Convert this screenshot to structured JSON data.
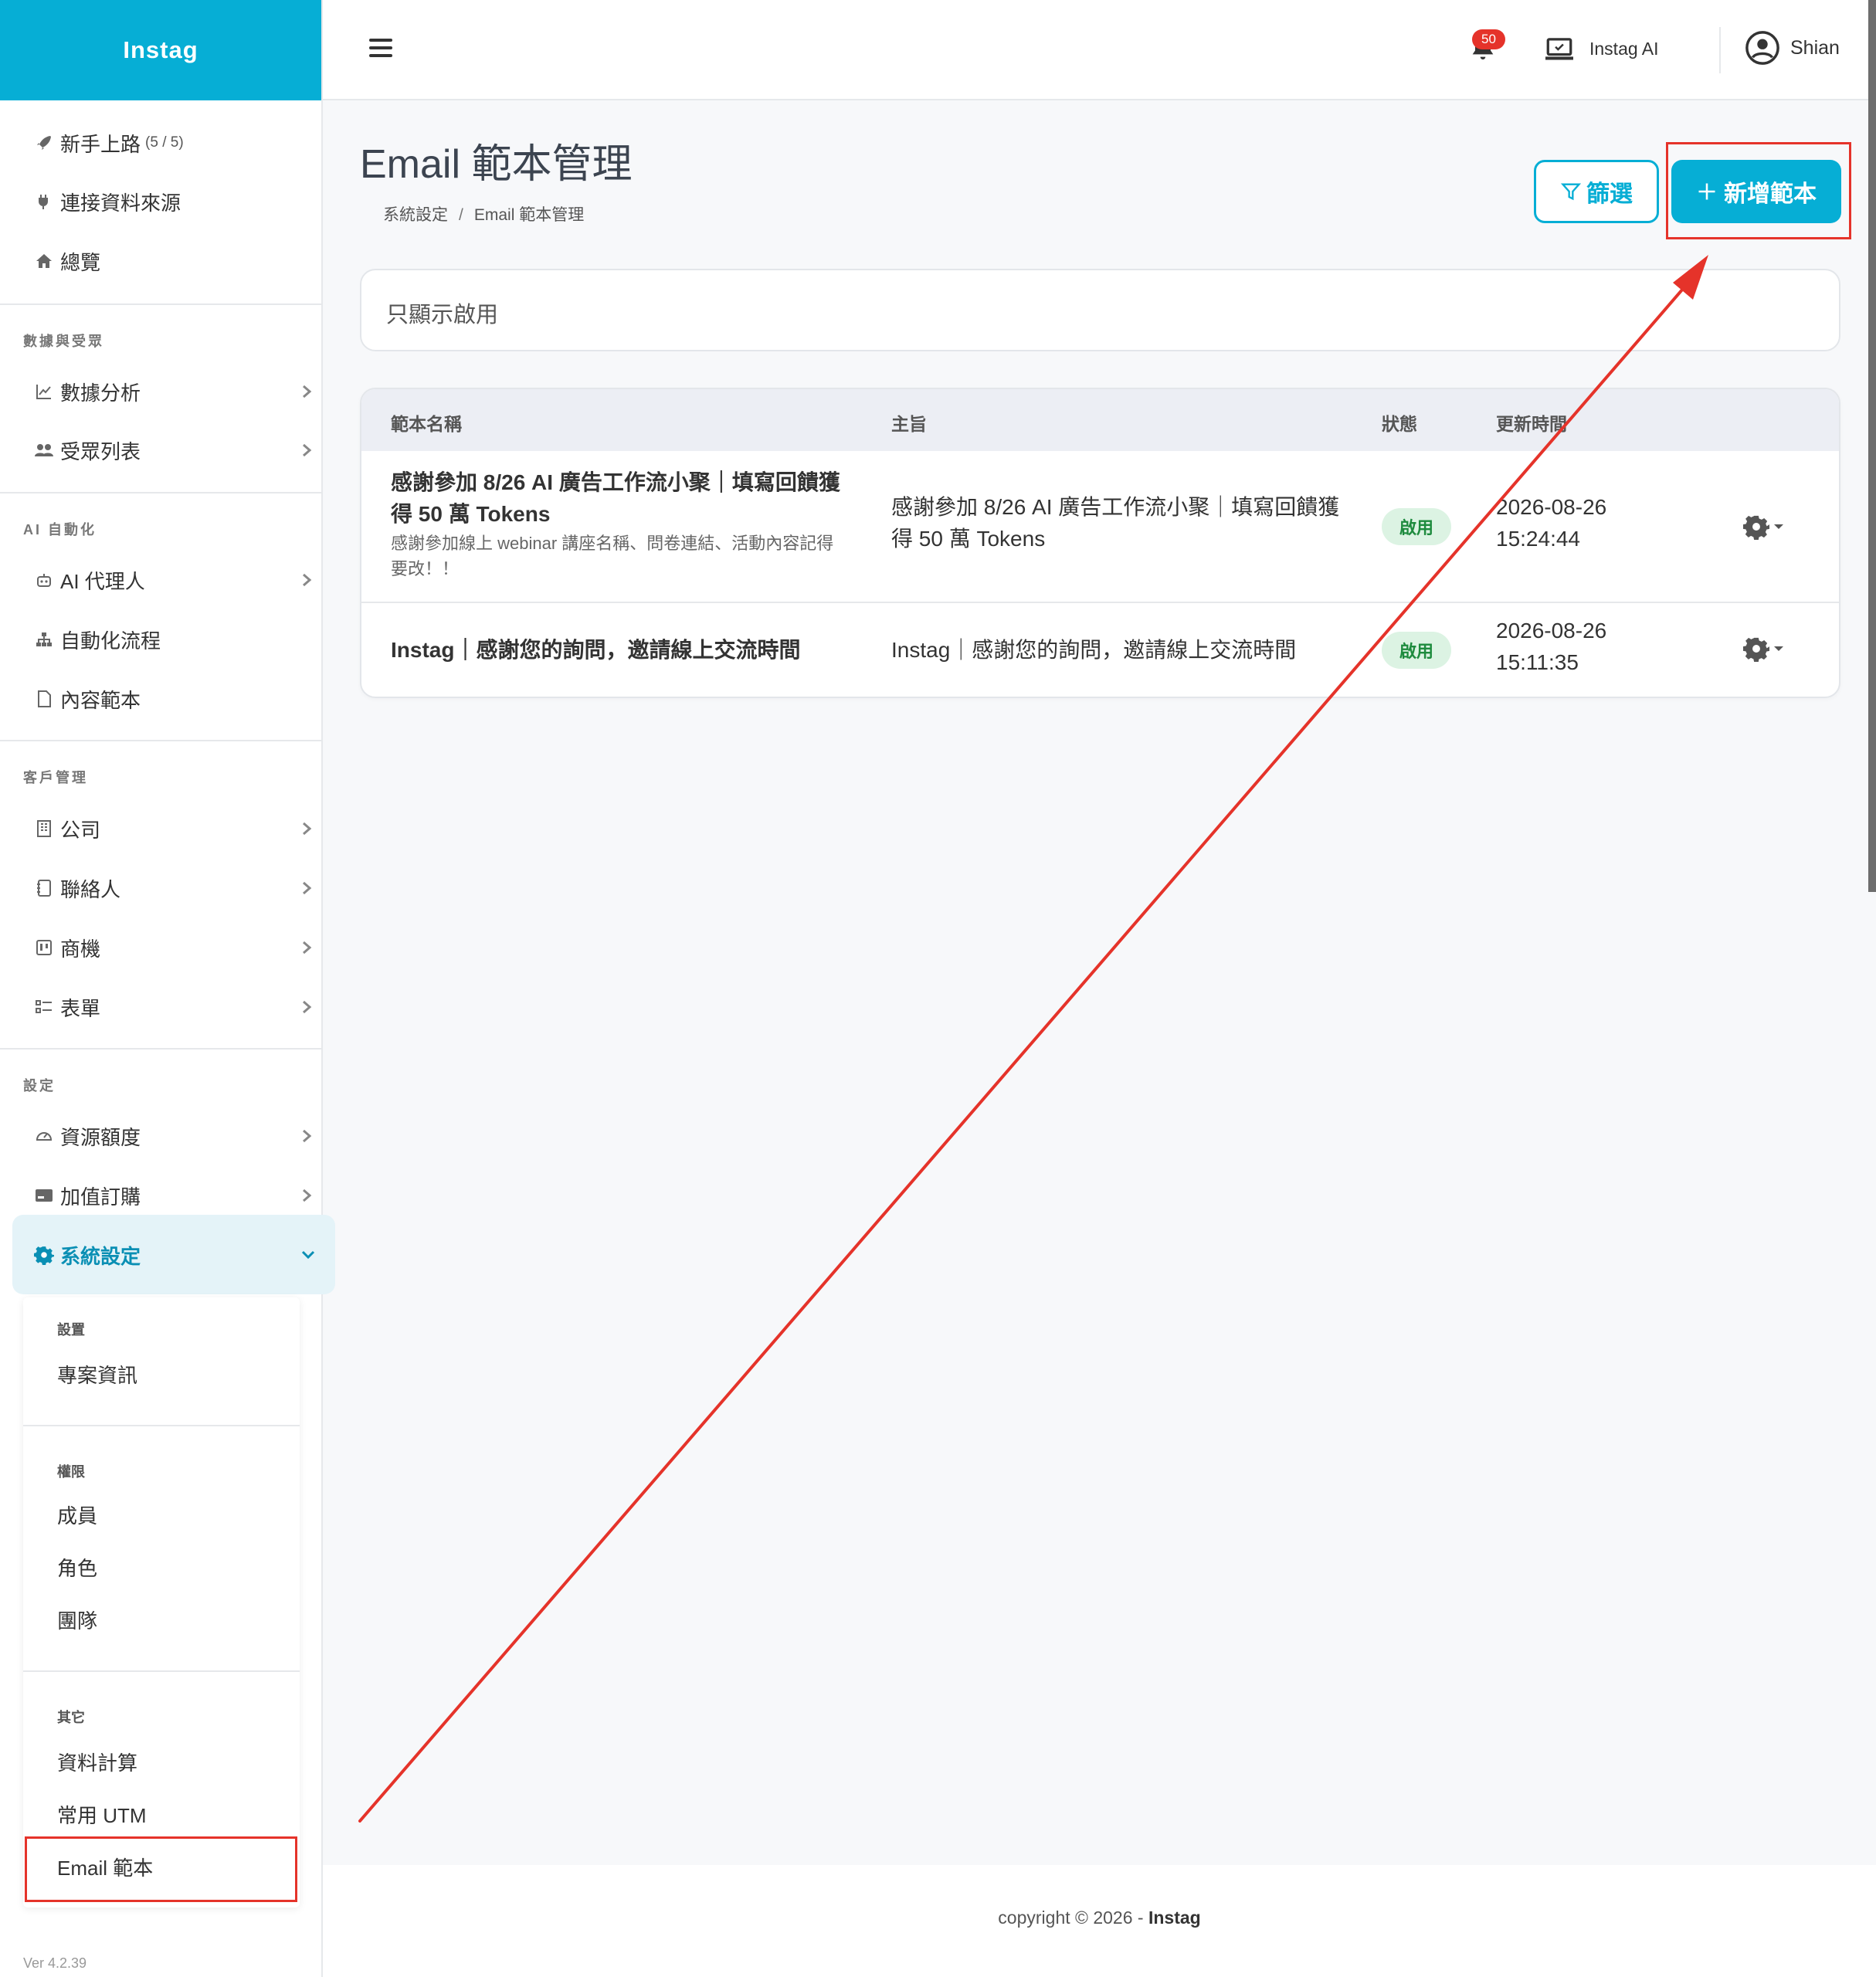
{
  "brand": "Instag",
  "sidebar": {
    "top_items": [
      {
        "label": "新手上路",
        "sub": "(5 / 5)"
      },
      {
        "label": "連接資料來源"
      },
      {
        "label": "總覽"
      }
    ],
    "sections": [
      {
        "title": "數據與受眾",
        "items": [
          "數據分析",
          "受眾列表"
        ]
      },
      {
        "title": "AI 自動化",
        "items": [
          "AI 代理人",
          "自動化流程",
          "內容範本"
        ]
      },
      {
        "title": "客戶管理",
        "items": [
          "公司",
          "聯絡人",
          "商機",
          "表單"
        ]
      },
      {
        "title": "設定",
        "items": [
          "資源額度",
          "加值訂購"
        ]
      }
    ],
    "active_item": "系統設定",
    "submenu": {
      "groups": [
        {
          "title": "設置",
          "items": [
            "專案資訊"
          ]
        },
        {
          "title": "權限",
          "items": [
            "成員",
            "角色",
            "團隊"
          ]
        },
        {
          "title": "其它",
          "items": [
            "資料計算",
            "常用 UTM",
            "Email 範本"
          ]
        }
      ]
    },
    "version": "Ver 4.2.39"
  },
  "topbar": {
    "notification_count": "50",
    "workspace": "Instag AI",
    "user": "Shian"
  },
  "page": {
    "title": "Email 範本管理",
    "breadcrumb": [
      "系統設定",
      "Email 範本管理"
    ],
    "breadcrumb_sep": "/",
    "filter_button": "篩選",
    "add_button": "新增範本",
    "filter_label": "只顯示啟用"
  },
  "table": {
    "headers": [
      "範本名稱",
      "主旨",
      "狀態",
      "更新時間"
    ],
    "rows": [
      {
        "name": "感謝參加 8/26 AI 廣告工作流小聚｜填寫回饋獲得 50 萬 Tokens",
        "desc": "感謝參加線上 webinar 講座名稱、問卷連結、活動內容記得要改！！",
        "subject": "感謝參加 8/26 AI 廣告工作流小聚｜填寫回饋獲得 50 萬 Tokens",
        "status": "啟用",
        "date": "2026-08-26",
        "time": "15:24:44"
      },
      {
        "name": "Instag｜感謝您的詢問，邀請線上交流時間",
        "desc": "",
        "subject": "Instag｜感謝您的詢問，邀請線上交流時間",
        "status": "啟用",
        "date": "2026-08-26",
        "time": "15:11:35"
      }
    ]
  },
  "footer": {
    "text": "copyright © 2026 -",
    "brand": "Instag"
  },
  "colors": {
    "accent": "#06aed5",
    "annotation": "#e5332a",
    "status_bg": "#dcf3e3",
    "status_text": "#1e8b3e"
  }
}
